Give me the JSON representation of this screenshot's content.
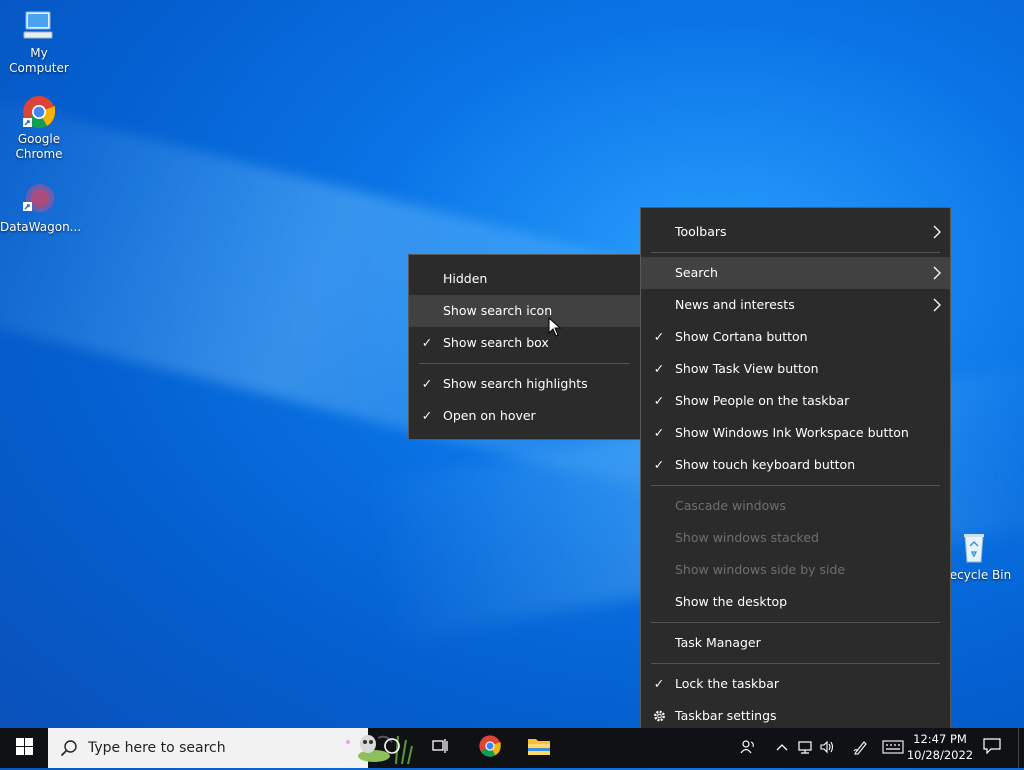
{
  "desktop": {
    "icons": [
      {
        "label": "My Computer"
      },
      {
        "label": "Google Chrome"
      },
      {
        "label": "DataWagon..."
      },
      {
        "label": "Recycle Bin"
      }
    ]
  },
  "context_menu": {
    "items": [
      {
        "label": "Toolbars",
        "checked": false,
        "submenu": true,
        "enabled": true
      },
      {
        "label": "Search",
        "checked": false,
        "submenu": true,
        "enabled": true,
        "highlighted": true
      },
      {
        "label": "News and interests",
        "checked": false,
        "submenu": true,
        "enabled": true
      },
      {
        "label": "Show Cortana button",
        "checked": true,
        "enabled": true
      },
      {
        "label": "Show Task View button",
        "checked": true,
        "enabled": true
      },
      {
        "label": "Show People on the taskbar",
        "checked": true,
        "enabled": true
      },
      {
        "label": "Show Windows Ink Workspace button",
        "checked": true,
        "enabled": true
      },
      {
        "label": "Show touch keyboard button",
        "checked": true,
        "enabled": true
      },
      {
        "label": "Cascade windows",
        "enabled": false
      },
      {
        "label": "Show windows stacked",
        "enabled": false
      },
      {
        "label": "Show windows side by side",
        "enabled": false
      },
      {
        "label": "Show the desktop",
        "enabled": true
      },
      {
        "label": "Task Manager",
        "enabled": true
      },
      {
        "label": "Lock the taskbar",
        "checked": true,
        "enabled": true
      },
      {
        "label": "Taskbar settings",
        "icon": "gear-icon",
        "enabled": true
      }
    ]
  },
  "search_submenu": {
    "items": [
      {
        "label": "Hidden",
        "checked": false
      },
      {
        "label": "Show search icon",
        "checked": false,
        "highlighted": true
      },
      {
        "label": "Show search box",
        "checked": true
      },
      {
        "label": "Show search highlights",
        "checked": true
      },
      {
        "label": "Open on hover",
        "checked": true
      }
    ]
  },
  "taskbar": {
    "search_placeholder": "Type here to search",
    "clock_time": "12:47 PM",
    "clock_date": "10/28/2022",
    "start_icon": "windows-logo-icon",
    "pinned": [
      "cortana-icon",
      "task-view-icon",
      "chrome-icon",
      "file-explorer-icon"
    ],
    "tray_icons": [
      "people-icon",
      "chevron-up-icon",
      "network-icon",
      "volume-icon",
      "ink-workspace-icon",
      "touch-keyboard-icon"
    ],
    "notification_icon": "notification-icon"
  },
  "colors": {
    "menu_bg": "#2b2b2b",
    "menu_highlight": "#414141",
    "menu_border": "#5a5a5a",
    "disabled_text": "#6e6e6e",
    "taskbar_bg": "#101114"
  }
}
